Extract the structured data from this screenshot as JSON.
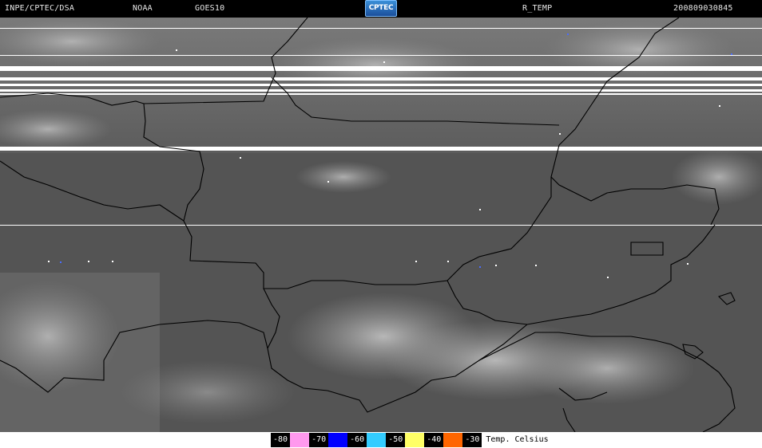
{
  "header": {
    "agency": "INPE/CPTEC/DSA",
    "source": "NOAA",
    "satellite": "GOES10",
    "logo_text": "CPTEC",
    "product": "R_TEMP",
    "timestamp": "200809030845"
  },
  "legend": {
    "items": [
      {
        "label": "-80",
        "color": "#ff99ee"
      },
      {
        "label": "-70",
        "color": "#0000ff"
      },
      {
        "label": "-60",
        "color": "#33ccff"
      },
      {
        "label": "-50",
        "color": "#ffff66"
      },
      {
        "label": "-40",
        "color": "#ff6600"
      },
      {
        "label": "-30",
        "color": ""
      }
    ],
    "caption": "Temp. Celsius"
  },
  "colors": {
    "boundary": "#000000",
    "scanline": "#ffffff"
  }
}
